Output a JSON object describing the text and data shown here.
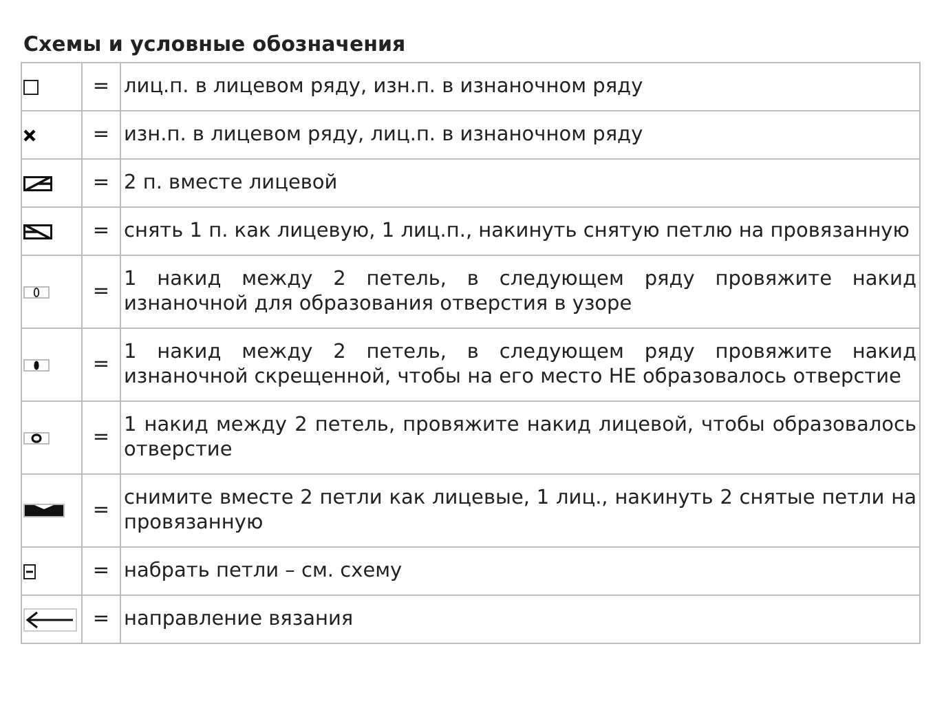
{
  "title": "Схемы и условные обозначения",
  "rows": [
    {
      "kind": "knit",
      "sign": "=",
      "text": "лиц.п. в лицевом ряду, изн.п. в изнаночном ряду"
    },
    {
      "kind": "purl",
      "sign": "=",
      "text": "изн.п. в лицевом ряду, лиц.п. в изнаночном ряду"
    },
    {
      "kind": "k2tog",
      "sign": "=",
      "text": "2 п. вместе лицевой"
    },
    {
      "kind": "skpo",
      "sign": "=",
      "text": "снять 1 п. как лицевую, 1 лиц.п., накинуть снятую петлю на провязанную"
    },
    {
      "kind": "yo",
      "sign": "=",
      "text": "1 накид между 2 петель, в следующем ряду провяжите накид изнаночной для образования отверстия в узоре"
    },
    {
      "kind": "yo-twisted",
      "sign": "=",
      "text": "1 накид между 2 петель, в следующем ряду провяжите накид изнаночной скрещенной, чтобы на его место НЕ образовалось отверстие"
    },
    {
      "kind": "yo-hole",
      "sign": "=",
      "text": "1 накид между 2 петель, провяжите накид лицевой, чтобы образовалось отверстие"
    },
    {
      "kind": "sk2po",
      "sign": "=",
      "text": "снимите вместе 2 петли как лицевые, 1 лиц., накинуть 2 снятые петли на провязанную"
    },
    {
      "kind": "cast-on",
      "sign": "=",
      "text": "набрать петли – см. схему"
    },
    {
      "kind": "arrow",
      "sign": "=",
      "text": "направление вязания"
    }
  ]
}
